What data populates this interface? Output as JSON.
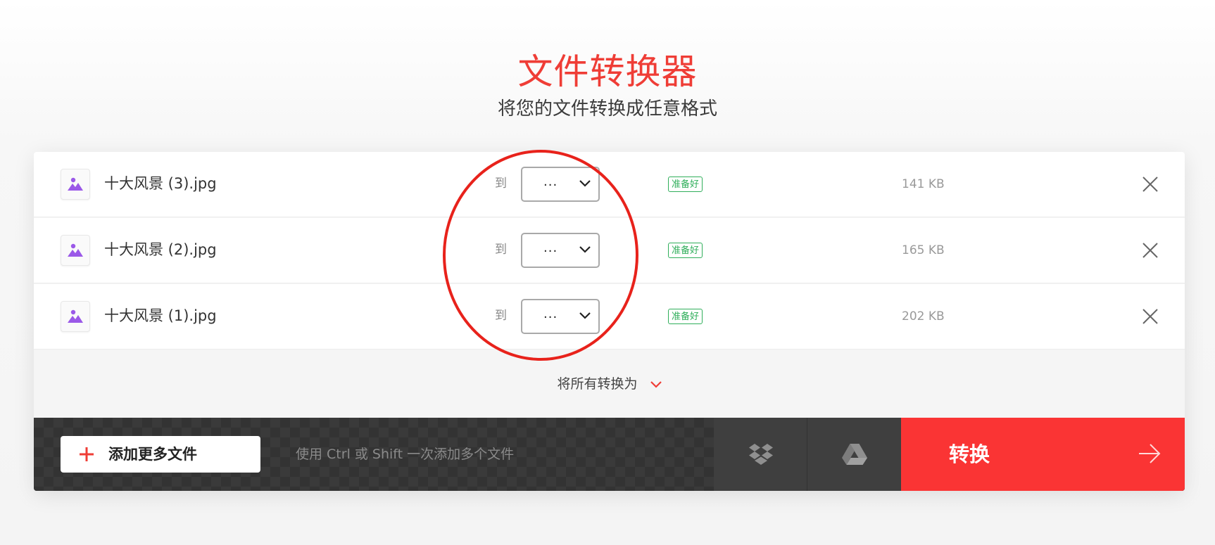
{
  "header": {
    "title": "文件转换器",
    "subtitle": "将您的文件转换成任意格式"
  },
  "files": [
    {
      "name": "十大风景 (3).jpg",
      "to_label": "到",
      "format": "...",
      "status": "准备好",
      "size": "141 KB"
    },
    {
      "name": "十大风景 (2).jpg",
      "to_label": "到",
      "format": "...",
      "status": "准备好",
      "size": "165 KB"
    },
    {
      "name": "十大风景 (1).jpg",
      "to_label": "到",
      "format": "...",
      "status": "准备好",
      "size": "202 KB"
    }
  ],
  "convert_all": {
    "label": "将所有转换为",
    "icon": "chevron-down-icon"
  },
  "bottom_bar": {
    "add_more_label": "添加更多文件",
    "hint": "使用 Ctrl 或 Shift 一次添加多个文件",
    "dropbox_icon": "dropbox-icon",
    "gdrive_icon": "google-drive-icon",
    "convert_label": "转换",
    "convert_icon": "arrow-right-icon"
  },
  "colors": {
    "accent": "#fa3434",
    "title": "#ef3d36",
    "status_ready": "#2fae5a",
    "file_icon": "#9b59e8",
    "annotation": "#e8221b"
  }
}
